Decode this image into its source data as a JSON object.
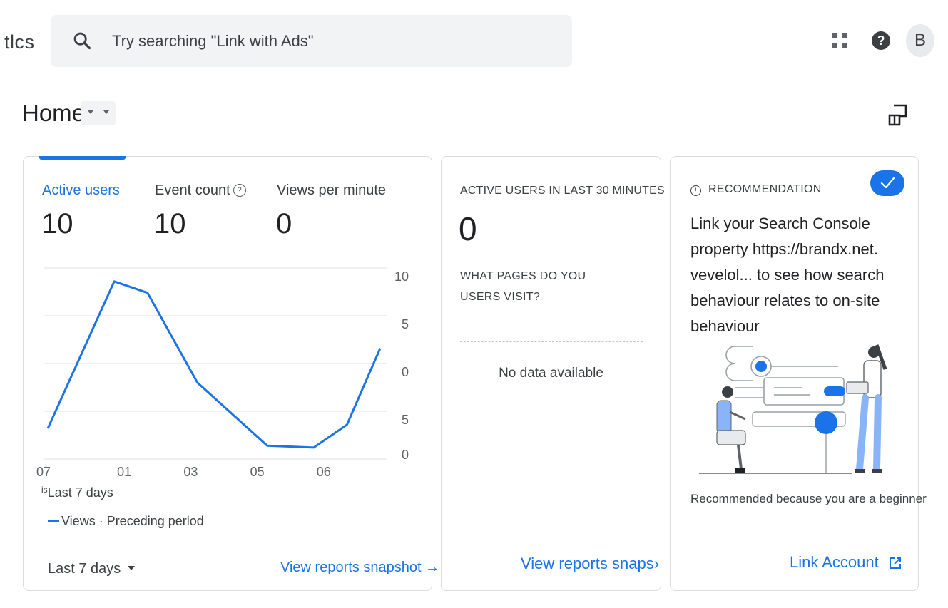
{
  "header": {
    "app_name": "tlcs",
    "search_placeholder": "Try searching \"Link with Ads\"",
    "avatar_initial": "B",
    "icons": [
      "search-icon",
      "apps-icon",
      "help-icon"
    ]
  },
  "page": {
    "title": "Home",
    "share_icon": "customize-icon"
  },
  "card_metrics": {
    "tabs": [
      {
        "label": "Active users",
        "value": "10",
        "active": true
      },
      {
        "label": "Event count",
        "value": "10",
        "active": false,
        "info_glyph": "?"
      },
      {
        "label": "Views per minute",
        "value": "0",
        "active": false
      }
    ],
    "legend_period": "Last 7 days",
    "legend_period_prefix": "is",
    "legend_series": "Views · Preceding perlod",
    "footer_range": "Last 7 days",
    "footer_link": "View reports snapshot →"
  },
  "chart_data": {
    "type": "line",
    "x_ticks": [
      "07",
      "01",
      "03",
      "05",
      "06"
    ],
    "y_ticks": [
      "10",
      "5",
      "0",
      "5",
      "0"
    ],
    "series": [
      {
        "name": "Views",
        "points": [
          {
            "x": 0.0,
            "y": 1.6
          },
          {
            "x": 1.0,
            "y": 9.3
          },
          {
            "x": 1.5,
            "y": 8.7
          },
          {
            "x": 2.25,
            "y": 4.0
          },
          {
            "x": 3.3,
            "y": 0.7
          },
          {
            "x": 4.0,
            "y": 0.6
          },
          {
            "x": 4.5,
            "y": 1.8
          },
          {
            "x": 5.0,
            "y": 5.8
          }
        ]
      }
    ],
    "ylim": [
      0,
      10
    ],
    "grid": true,
    "color": "#1a73e8"
  },
  "card_realtime": {
    "title": "ACTIVE USERS IN LAST 30 MINUTES",
    "value": "0",
    "question": "WHAT PAGES DO YOU USERS VISIT?",
    "empty_text": "No data available",
    "link": "View reports snaps›"
  },
  "card_recommendation": {
    "label": "RECOMMENDATION",
    "info_glyph": "!",
    "text": "Link your Search Console property https://brandx.net. vevelol... to see how search behaviour relates to on-site behaviour",
    "reason": "Recommended because you are a beginner",
    "action": "Link Account",
    "check_icon": "check-icon",
    "ext_icon": "open-in-new-icon"
  },
  "colors": {
    "accent": "#1a73e8",
    "search_bg": "#f1f3f4",
    "border": "#dadce0"
  }
}
